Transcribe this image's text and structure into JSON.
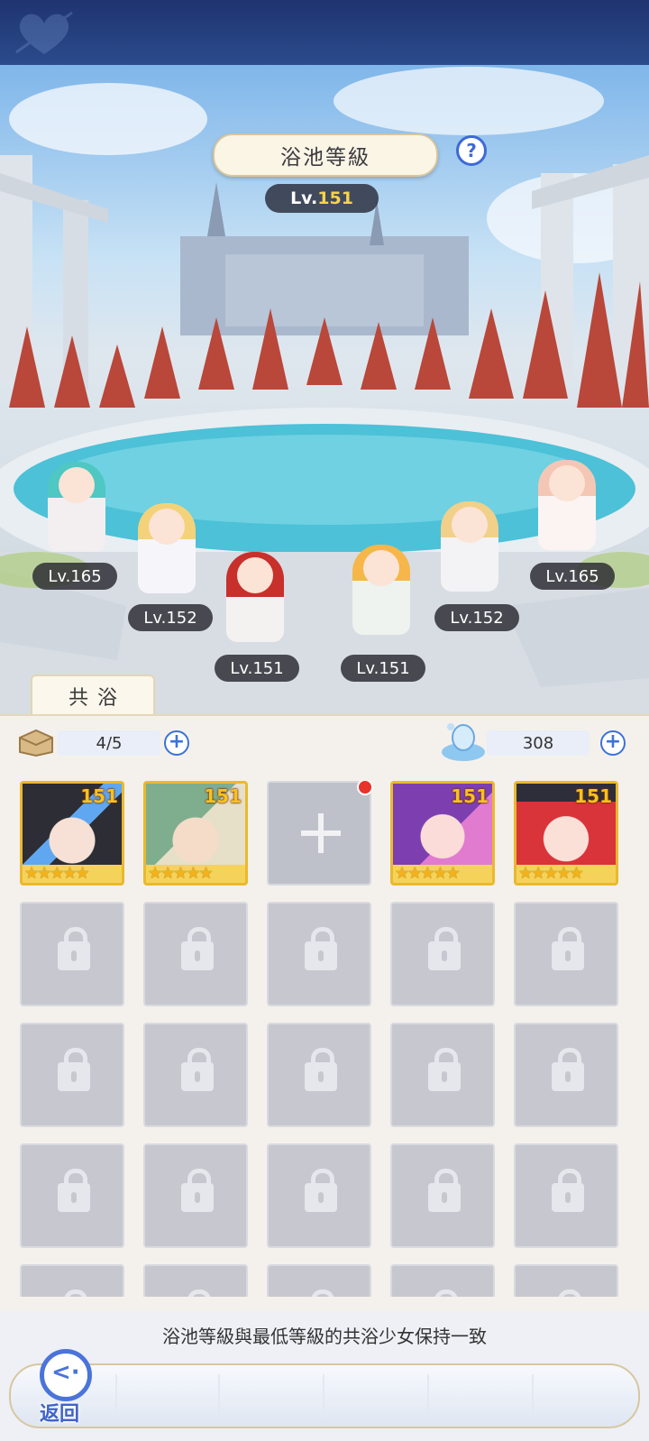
{
  "header": {
    "title": "浴池等級",
    "help_symbol": "?",
    "level_prefix": "Lv.",
    "level_value": "151"
  },
  "scene_girls": [
    {
      "level": "Lv.165",
      "hair": "#4fc7c2"
    },
    {
      "level": "Lv.152",
      "hair": "#f3d27a"
    },
    {
      "level": "Lv.151",
      "hair": "#c8302c"
    },
    {
      "level": "Lv.151",
      "hair": "#f6b64a"
    },
    {
      "level": "Lv.152",
      "hair": "#f1d08a"
    },
    {
      "level": "Lv.165",
      "hair": "#f4c7b4"
    }
  ],
  "tab": {
    "label": "共浴"
  },
  "resources": {
    "slots": {
      "value": "4/5",
      "icon": "parcel-icon"
    },
    "bubbles": {
      "value": "308",
      "icon": "bath-bubble-icon"
    }
  },
  "roster": {
    "row1": [
      {
        "type": "hero",
        "level": "151",
        "stars": "★★★★★",
        "hair": "#2d2d35",
        "accent": "#5fa7f0"
      },
      {
        "type": "hero",
        "level": "151",
        "stars": "★★★★★",
        "hair": "#7fae8f",
        "accent": "#e6e0c8"
      },
      {
        "type": "add",
        "has_notification": true
      },
      {
        "type": "hero",
        "level": "151",
        "stars": "★★★★★",
        "hair": "#7d3fb0",
        "accent": "#e07bd0"
      },
      {
        "type": "hero",
        "level": "151",
        "stars": "★★★★★",
        "hair": "#d8343a",
        "accent": "#2e2e3a"
      }
    ],
    "locked_rows": 4
  },
  "hint": "浴池等級與最低等級的共浴少女保持一致",
  "footer": {
    "back_label": "返回"
  },
  "colors": {
    "accent_blue": "#3d72d8",
    "level_gold": "#f7d34a",
    "notification_red": "#e8332a"
  }
}
